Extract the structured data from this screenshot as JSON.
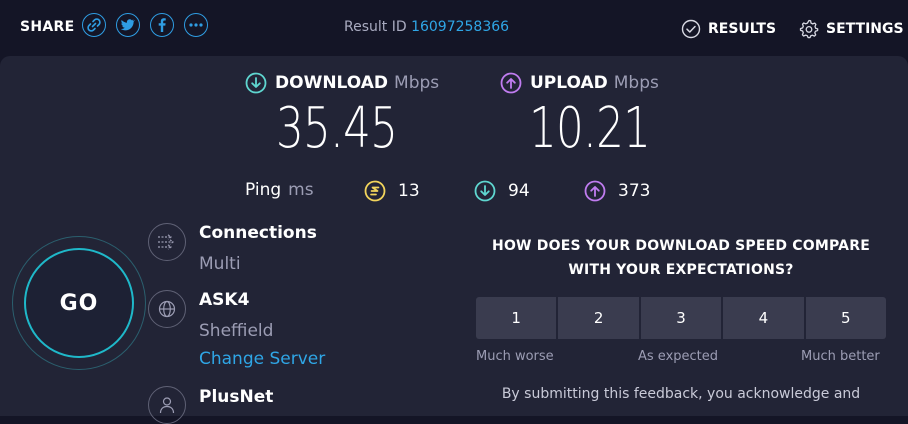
{
  "topbar": {
    "share_label": "SHARE",
    "share_icons": [
      "link-icon",
      "twitter-icon",
      "facebook-icon",
      "more-icon"
    ],
    "result_label": "Result ID",
    "result_id": "16097258366",
    "results_label": "RESULTS",
    "settings_label": "SETTINGS"
  },
  "speeds": {
    "download": {
      "label": "DOWNLOAD",
      "unit": "Mbps",
      "value": "35.45"
    },
    "upload": {
      "label": "UPLOAD",
      "unit": "Mbps",
      "value": "10.21"
    }
  },
  "ping": {
    "label": "Ping",
    "unit": "ms",
    "idle": "13",
    "download": "94",
    "upload": "373"
  },
  "go": {
    "label": "GO"
  },
  "connections": {
    "title": "Connections",
    "value": "Multi"
  },
  "server": {
    "name": "ASK4",
    "location": "Sheffield",
    "change_label": "Change Server"
  },
  "provider": {
    "name": "PlusNet"
  },
  "feedback": {
    "question_line1": "HOW DOES YOUR DOWNLOAD SPEED COMPARE",
    "question_line2": "WITH YOUR EXPECTATIONS?",
    "options": [
      "1",
      "2",
      "3",
      "4",
      "5"
    ],
    "scale_low": "Much worse",
    "scale_mid": "As expected",
    "scale_high": "Much better",
    "disclaimer": "By submitting this feedback, you acknowledge and"
  },
  "colors": {
    "background": "#141526",
    "panel": "#222436",
    "accent_link": "#2fa6e6",
    "download": "#5fd6d0",
    "upload": "#c07cf0",
    "ping_idle": "#f2d45c",
    "go_ring": "#1fb8c9"
  }
}
